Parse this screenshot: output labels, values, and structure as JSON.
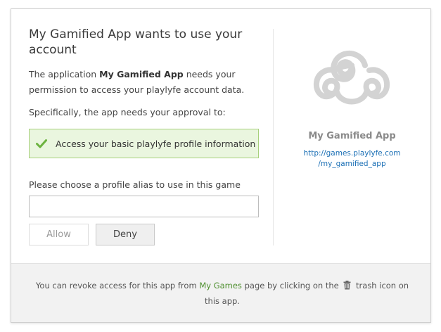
{
  "dialog": {
    "title": "My Gamified App wants to use your account",
    "desc_prefix": "The application ",
    "app_name_inline": "My Gamified App",
    "desc_suffix": " needs your permission to access your playlyfe account data.",
    "specifically": "Specifically, the app needs your approval to:",
    "permissions": [
      "Access your basic playlyfe profile information"
    ],
    "alias_label": "Please choose a profile alias to use in this game",
    "alias_value": "",
    "alias_placeholder": "",
    "allow_label": "Allow",
    "deny_label": "Deny"
  },
  "app_info": {
    "name": "My Gamified App",
    "url_line1": "http://games.playlyfe.com",
    "url_line2": "/my_gamified_app",
    "logo_icon": "triskelion-logo"
  },
  "footer": {
    "text_before": "You can revoke access for this app from ",
    "link_label": "My Games",
    "text_middle": " page by clicking on the ",
    "icon": "trash-icon",
    "text_after": " trash icon on this app."
  },
  "colors": {
    "permission_bg": "#eaf6df",
    "permission_border": "#a7d07b",
    "check": "#6cb33f",
    "link_green": "#4e8f2e",
    "link_blue": "#1a6fb5",
    "logo_gray": "#d3d3d3"
  }
}
